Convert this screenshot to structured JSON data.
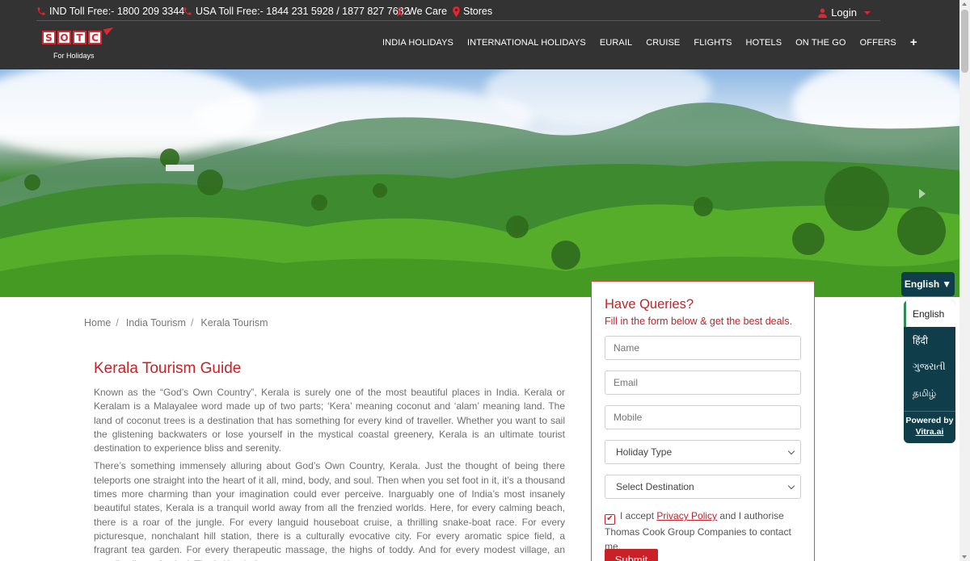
{
  "topbar": {
    "ind_toll_free": "IND Toll Free:- 1800 209 3344",
    "usa_toll_free": "USA Toll Free:- 1844 231 5928 / 1877 827 7682",
    "we_care": "We Care",
    "stores": "Stores",
    "login": "Login"
  },
  "logo": {
    "letters": [
      "S",
      "O",
      "T",
      "C"
    ],
    "tagline": "For Holidays"
  },
  "nav": {
    "items": [
      "INDIA HOLIDAYS",
      "INTERNATIONAL HOLIDAYS",
      "EURAIL",
      "CRUISE",
      "FLIGHTS",
      "HOTELS",
      "ON THE GO",
      "OFFERS"
    ],
    "more": "+"
  },
  "breadcrumb": {
    "home": "Home",
    "india": "India Tourism",
    "current": "Kerala Tourism",
    "separator": "/"
  },
  "article": {
    "title": "Kerala Tourism Guide",
    "paragraphs": [
      "Known as the “God’s Own Country”, Kerala is surely one of the most beautiful places in India. Kerala or Keralam is a Malayalee word made up of two parts; ‘Kera’ meaning coconut and ‘alam’ meaning land. The land of coconut trees is a destination that has something for every kind of traveller. Whether you want to sail the glistening backwaters or lose yourself in the mystical coastal greenery, Kerala is an ultimate tourist destination to experience bliss and serenity.",
      "There’s something immensely alluring about God’s Own Country, Kerala. Just the thought of being there teleports one straight into the heart of it all, mind, body, and soul. Then when you set foot in it, it’s a thousand times more charming than your imagination could ever perceive. Inarguably one of India’s most insanely beautiful states, Kerala is a tranquil world away from all the frenzied worlds. Here, for every calming beach, there is a roar of the jungle. For every languid houseboat cruise, a thrilling snake-boat race. For every picturesque, nonchalant hill station, there is a culturally evocative city. For every aromatic spice field, a fragrant tea garden. For every therapeutic massage, the highs of toddy. And for every modest village, an equally vibrant festival. That’s Kerala for"
    ]
  },
  "form": {
    "title": "Have Queries?",
    "subtitle": "Fill in the form below & get the best deals.",
    "name_placeholder": "Name",
    "email_placeholder": "Email",
    "mobile_placeholder": "Mobile",
    "holiday_type": "Holiday Type",
    "destination": "Select Destination",
    "consent_pre": "I accept",
    "consent_link": "Privacy Policy",
    "consent_post": "and I authorise Thomas Cook Group Companies to contact me.",
    "submit": "Submit"
  },
  "language": {
    "selected": "English",
    "selector_arrow": "▼",
    "options": [
      "English",
      "हिंदी",
      "ગુજરાતી",
      "தமிழ்"
    ],
    "powered_by": "Powered by",
    "powered_brand": "Vitra.ai"
  },
  "colors": {
    "brand_red": "#c82127",
    "header_bg": "#333333",
    "lang_widget_bg": "#0f3d4a"
  }
}
